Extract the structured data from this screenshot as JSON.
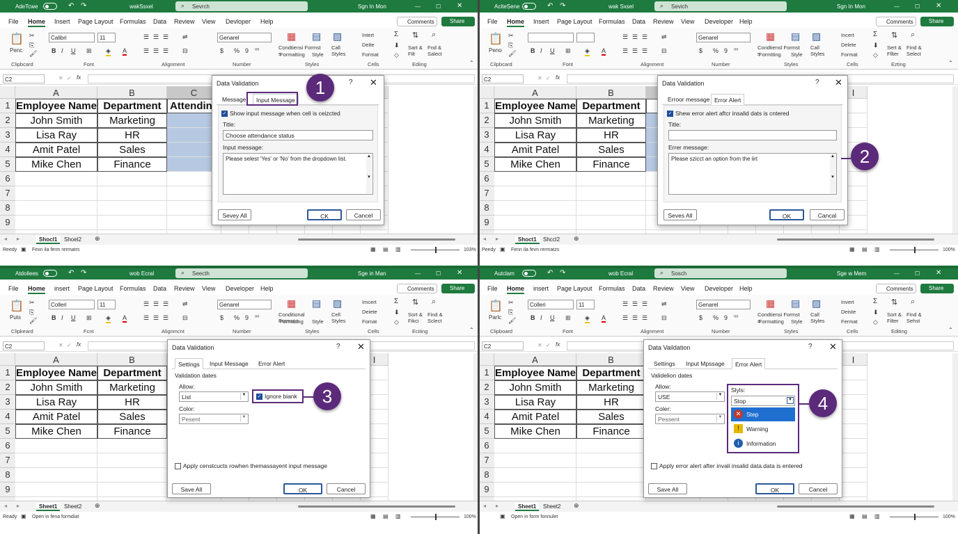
{
  "panels": [
    {
      "app_name": "AdeTcwe",
      "title": "wakSsxel",
      "search": "Sevrch",
      "signin": "Sgn In Mon",
      "menu": [
        "File",
        "Home",
        "Insert",
        "Page Layout",
        "Formulas",
        "Data",
        "Review",
        "View",
        "Devloper",
        "Help"
      ],
      "comments": "Comments",
      "share": "Share",
      "font": "Calibri",
      "size": "11",
      "numfmt": "Genarel",
      "groups": {
        "clip": "Clipbcard",
        "font": "Font",
        "align": "Alignment",
        "number": "Number",
        "styles": "Styles",
        "cells": "Cells",
        "editing": "Ediing"
      },
      "paste": "Penc",
      "cond": "Condtiensi Formst s",
      "cond2": "Formatting",
      "fmt_as": "Style",
      "cell_styles": "Call Styles",
      "ins": "Intert",
      "del": "Delte",
      "fmt": "Format",
      "sort": "Sart & Filt",
      "find": "Fnd & Salect",
      "namebox": "C2",
      "cols": [
        "A",
        "B",
        "C",
        "D",
        "E",
        "F",
        "G",
        "H",
        "I"
      ],
      "rows": [
        "1",
        "2",
        "3",
        "4",
        "5",
        "6",
        "7",
        "8",
        "9",
        "10"
      ],
      "table": [
        [
          "Employee Name",
          "Department",
          "Attending"
        ],
        [
          "John Smith",
          "Marketing",
          ""
        ],
        [
          "Lisa Ray",
          "HR",
          ""
        ],
        [
          "Amit Patel",
          "Sales",
          ""
        ],
        [
          "Mike Chen",
          "Finance",
          ""
        ]
      ],
      "sheets": [
        "Shocl1",
        "Shoel2"
      ],
      "status": "Reedy",
      "status2": "Fexn ila ferm rermatrs",
      "zoom": "103%",
      "dialog": {
        "title": "Data Validation",
        "tabs": [
          "Message",
          "Input Message"
        ],
        "check": "Show input message when cell is ceizcted",
        "title_label": "Title:",
        "title_value": "Choose attendance status",
        "msg_label": "Input message:",
        "msg_value": "Please selest 'Yes' or 'No' from the dropdown list.",
        "btn_left": "Sevey All",
        "ok": "CK",
        "cancel": "Cancel"
      },
      "callout": "1"
    },
    {
      "app_name": "AciteSene",
      "title": "wak Sxsel",
      "search": "Sevich",
      "signin": "Sgn In Mon",
      "menu": [
        "File",
        "Home",
        "Insert",
        "Page Layout",
        "Formulas",
        "Data",
        "Review",
        "View",
        "Developer",
        "Help"
      ],
      "comments": "Comments",
      "share": "Share",
      "font": "",
      "size": "",
      "numfmt": "Genarel",
      "groups": {
        "clip": "Cilpbcard",
        "font": "Font",
        "align": "Alignment",
        "number": "Number",
        "styles": "Styles",
        "cells": "Cells",
        "editing": "Ezting"
      },
      "paste": "Peno",
      "cond": "Condtiensl Formst s",
      "cond2": "Formtting",
      "fmt_as": "Style",
      "cell_styles": "Call Styles",
      "ins": "Incert",
      "del": "Delete",
      "fmt": "Format",
      "sort": "Sert & Fllter",
      "find": "Find & Select",
      "namebox": "C2",
      "cols": [
        "A",
        "B",
        "C",
        "D",
        "E",
        "F",
        "G",
        "H",
        "I"
      ],
      "rows": [
        "1",
        "2",
        "3",
        "4",
        "5",
        "6",
        "7",
        "8",
        "9",
        "10"
      ],
      "table": [
        [
          "Employee Name",
          "Department",
          "Atte"
        ],
        [
          "John Smith",
          "Marketing",
          ""
        ],
        [
          "Lisa Ray",
          "HR",
          ""
        ],
        [
          "Amit Patel",
          "Sales",
          ""
        ],
        [
          "Mike Chen",
          "Finance",
          ""
        ]
      ],
      "sheets": [
        "Shoct1",
        "Shccl2"
      ],
      "status": "Peedy",
      "status2": "Fenn ila fevn rermatzs",
      "zoom": "100%",
      "dialog": {
        "title": "Data Validation",
        "tabs": [
          "Erroor message",
          "Error Alert"
        ],
        "check": "Shew error alert aftcr insalid dats is cntered",
        "title_label": "Title:",
        "title_value": "",
        "msg_label": "Errer message:",
        "msg_value": "Please szicct an option from the iirt",
        "btn_left": "Seves All",
        "ok": "OK",
        "cancel": "Cancal"
      },
      "callout": "2"
    },
    {
      "app_name": "Atdollees",
      "title": "wob Ecral",
      "search": "Seecth",
      "signin": "Sge in Man",
      "menu": [
        "File",
        "Home",
        "insert",
        "Page Layout",
        "Formulas",
        "Data",
        "Review",
        "View",
        "Developer",
        "Help"
      ],
      "comments": "Comments",
      "share": "Share",
      "font": "Colleri",
      "size": "11",
      "numfmt": "Genarel",
      "groups": {
        "clip": "Clipkeard",
        "font": "Fcnt",
        "align": "Alignmcnt",
        "number": "Number",
        "styles": "Styles",
        "cells": "Cells",
        "editing": "Eciting"
      },
      "paste": "Puts",
      "cond": "Conditional Formst s",
      "cond2": "Formating",
      "fmt_as": "Style",
      "cell_styles": "Cell Styles",
      "ins": "Imcert",
      "del": "Deiete",
      "fmt": "Fomat",
      "sort": "Sort & Fikci",
      "find": "Find & Sclect",
      "namebox": "C2",
      "cols": [
        "A",
        "B",
        "C",
        "D",
        "E",
        "F",
        "G",
        "H",
        "I"
      ],
      "rows": [
        "1",
        "2",
        "3",
        "4",
        "5",
        "6",
        "7",
        "8",
        "9",
        "10"
      ],
      "table": [
        [
          "Employee Name",
          "Department",
          "A"
        ],
        [
          "John Smith",
          "Marketing",
          ""
        ],
        [
          "Lisa Ray",
          "HR",
          ""
        ],
        [
          "Amit Patel",
          "Sales",
          ""
        ],
        [
          "Mike Chen",
          "Finance",
          ""
        ]
      ],
      "sheets": [
        "Sheet1",
        "Sheet2"
      ],
      "status": "Ready",
      "status2": "Open in fena formdiat",
      "zoom": "100%",
      "dialog": {
        "title": "Data Validation",
        "tabs": [
          "Settings",
          "Input Message",
          "Error Alert"
        ],
        "section": "Validation dates",
        "allow_label": "Allow:",
        "allow_value": "List",
        "color_label": "Color:",
        "color_value": "Pesent",
        "ignore": "Ignore biank",
        "apply": "Apply censtcucts rowhen themassayent input message",
        "btn_left": "Save All",
        "ok": "OK",
        "cancel": "Cancel"
      },
      "callout": "3"
    },
    {
      "app_name": "Autclam",
      "title": "wob Ecral",
      "search": "Sosch",
      "signin": "Sge w Mem",
      "menu": [
        "File",
        "Home",
        "insert",
        "Page Layout",
        "Formulas",
        "Data",
        "Review",
        "View",
        "Developer",
        "Help"
      ],
      "comments": "Comments",
      "share": "Share",
      "font": "Colleri",
      "size": "11",
      "numfmt": "Genarel",
      "groups": {
        "clip": "Clipboard",
        "font": "Font",
        "align": "Alignment",
        "number": "Number",
        "styles": "Styles",
        "cells": "Cells",
        "editing": "Editing"
      },
      "paste": "Parlc",
      "cond": "Condtiensi Formst a",
      "cond2": "Formatting",
      "fmt_as": "Style",
      "cell_styles": "Call Styles",
      "ins": "Invert",
      "del": "Deiste",
      "fmt": "Fermat",
      "sort": "Sort & Filter",
      "find": "Find & Sehst",
      "namebox": "C2",
      "cols": [
        "A",
        "B",
        "C",
        "D",
        "E",
        "F",
        "G",
        "H",
        "I"
      ],
      "rows": [
        "1",
        "2",
        "3",
        "4",
        "5",
        "6",
        "7",
        "8",
        "9",
        "10"
      ],
      "table": [
        [
          "Employee Name",
          "Department",
          ""
        ],
        [
          "John Smith",
          "Marketing",
          ""
        ],
        [
          "Lisa Ray",
          "HR",
          ""
        ],
        [
          "Amit Patel",
          "Sales",
          ""
        ],
        [
          "Mike Chen",
          "Finance",
          ""
        ]
      ],
      "sheets": [
        "Sheet1",
        "Sheet2"
      ],
      "status": "",
      "status2": "Open in form fonnulet",
      "zoom": "100%",
      "dialog": {
        "title": "Data Vaildation",
        "tabs": [
          "Settings",
          "Input Mpssage",
          "Error Alert"
        ],
        "section": "Validelion dates",
        "allow_label": "Allow:",
        "allow_value": "USE",
        "color_label": "Coler:",
        "color_value": "Pessent",
        "style_label": "Slyls:",
        "style_value": "Stop",
        "options": [
          "Step",
          "Warning",
          "Information"
        ],
        "apply": "Apply error alert after invali insalid data.data is entered",
        "btn_left": "Save All",
        "ok": "OK",
        "cancel": "Cancel"
      },
      "callout": "4"
    }
  ],
  "colors": {
    "excel_green": "#1e7a3f",
    "callout_purple": "#5b2a7a",
    "selection_blue": "#b7c9e2",
    "dropdown_highlight": "#1f6fd1"
  }
}
